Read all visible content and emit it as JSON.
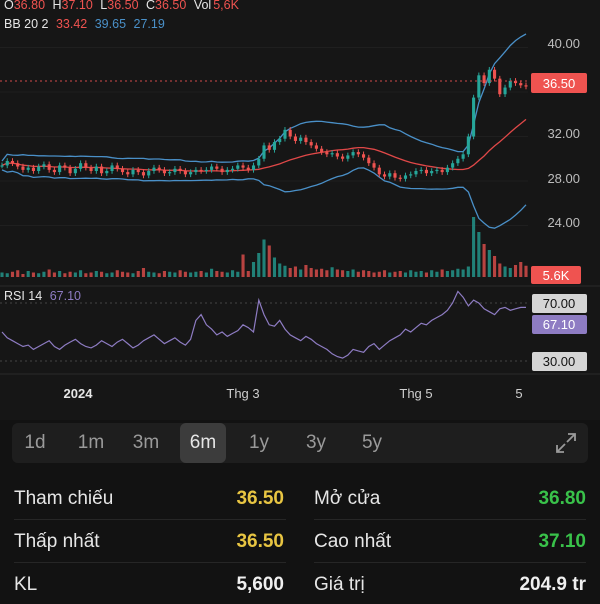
{
  "chart_data": {
    "type": "candlestick",
    "header": {
      "ohlc": [
        {
          "label": "O",
          "value": "36.80"
        },
        {
          "label": "H",
          "value": "37.10"
        },
        {
          "label": "L",
          "value": "36.50"
        },
        {
          "label": "C",
          "value": "36.50"
        },
        {
          "label": "Vol",
          "value": "5,6K"
        }
      ],
      "bb": {
        "label": "BB 20 2",
        "upper": "33.42",
        "middle": "39.65",
        "lower": "27.19"
      }
    },
    "price_axis": {
      "ticks": [
        "40.00",
        "36.00",
        "32.00",
        "28.00",
        "24.00"
      ],
      "ylim": [
        20,
        44
      ]
    },
    "current_price_label": "36.50",
    "volume_label": "5.6K",
    "rsi": {
      "label": "RSI 14",
      "value": "67.10",
      "levels": [
        "70.00",
        "30.00"
      ],
      "current_label": "67.10"
    },
    "x_ticks": [
      "2024",
      "Thg 3",
      "Thg 5",
      "5"
    ],
    "price_series": [
      29.4,
      29.8,
      29.6,
      29.3,
      29.0,
      29.2,
      28.9,
      29.3,
      29.5,
      29.0,
      28.8,
      29.4,
      29.2,
      28.7,
      29.1,
      29.6,
      29.2,
      28.9,
      29.3,
      28.7,
      28.9,
      29.4,
      29.1,
      28.8,
      28.6,
      29.0,
      28.8,
      28.5,
      28.9,
      29.2,
      29.0,
      28.7,
      28.8,
      29.1,
      28.9,
      28.6,
      28.8,
      29.0,
      28.9,
      29.0,
      29.3,
      29.1,
      28.8,
      29.0,
      29.1,
      29.4,
      29.2,
      29.0,
      29.4,
      30.0,
      31.2,
      30.8,
      31.5,
      31.8,
      32.6,
      32.0,
      31.6,
      31.9,
      31.5,
      31.2,
      30.9,
      30.6,
      30.4,
      30.5,
      30.2,
      30.0,
      30.3,
      30.6,
      30.4,
      30.1,
      29.6,
      29.2,
      28.6,
      28.4,
      28.7,
      28.3,
      28.2,
      28.5,
      28.6,
      28.9,
      29.0,
      28.7,
      28.9,
      29.0,
      28.8,
      29.2,
      29.6,
      30.0,
      30.4,
      32.0,
      35.5,
      37.5,
      36.8,
      38.0,
      37.2,
      35.8,
      36.4,
      37.0,
      36.8,
      36.6,
      36.5
    ],
    "volume_series": [
      0.6,
      0.5,
      0.7,
      0.9,
      0.4,
      0.8,
      0.6,
      0.5,
      0.7,
      1.0,
      0.6,
      0.8,
      0.5,
      0.7,
      0.6,
      0.9,
      0.5,
      0.6,
      0.8,
      0.7,
      0.5,
      0.6,
      0.9,
      0.7,
      0.6,
      0.5,
      0.8,
      1.2,
      0.7,
      0.6,
      0.5,
      0.8,
      0.7,
      0.6,
      0.9,
      0.7,
      0.6,
      0.7,
      0.8,
      0.6,
      1.1,
      0.8,
      0.7,
      0.6,
      0.9,
      0.7,
      3.0,
      0.8,
      2.0,
      3.2,
      5.0,
      4.2,
      2.6,
      1.8,
      1.5,
      1.2,
      1.4,
      1.0,
      1.6,
      1.2,
      1.0,
      1.1,
      0.9,
      1.3,
      1.0,
      0.9,
      0.8,
      1.0,
      0.7,
      0.9,
      0.8,
      0.6,
      0.7,
      0.9,
      0.6,
      0.7,
      0.8,
      0.6,
      0.9,
      0.7,
      0.8,
      0.6,
      0.9,
      0.7,
      1.0,
      0.8,
      0.9,
      1.1,
      1.0,
      1.4,
      8.0,
      6.0,
      4.4,
      3.6,
      2.8,
      1.8,
      1.4,
      1.2,
      1.6,
      2.0,
      1.5
    ],
    "rsi_series": [
      50,
      46,
      44,
      42,
      40,
      41,
      38,
      40,
      42,
      44,
      40,
      38,
      41,
      43,
      45,
      42,
      40,
      39,
      41,
      44,
      42,
      40,
      43,
      45,
      42,
      39,
      41,
      44,
      46,
      48,
      45,
      42,
      44,
      46,
      43,
      41,
      45,
      58,
      62,
      55,
      52,
      48,
      50,
      47,
      49,
      51,
      55,
      53,
      50,
      72,
      62,
      55,
      54,
      58,
      52,
      48,
      46,
      44,
      47,
      45,
      42,
      40,
      38,
      35,
      33,
      32,
      34,
      38,
      37,
      36,
      40,
      42,
      38,
      41,
      44,
      46,
      48,
      52,
      50,
      53,
      56,
      55,
      58,
      60,
      62,
      65,
      70,
      78,
      74,
      68,
      72,
      70,
      66,
      64,
      62,
      66,
      67,
      65,
      66,
      67,
      67
    ]
  },
  "range_tabs": [
    {
      "label": "1d",
      "active": false
    },
    {
      "label": "1m",
      "active": false
    },
    {
      "label": "3m",
      "active": false
    },
    {
      "label": "6m",
      "active": true
    },
    {
      "label": "1y",
      "active": false
    },
    {
      "label": "3y",
      "active": false
    },
    {
      "label": "5y",
      "active": false
    }
  ],
  "stats": {
    "rows": [
      {
        "left_label": "Tham chiếu",
        "left_value": "36.50",
        "left_color": "#e8c542",
        "right_label": "Mở cửa",
        "right_value": "36.80",
        "right_color": "#39c24a"
      },
      {
        "left_label": "Thấp nhất",
        "left_value": "36.50",
        "left_color": "#e8c542",
        "right_label": "Cao nhất",
        "right_value": "37.10",
        "right_color": "#39c24a"
      },
      {
        "left_label": "KL",
        "left_value": "5,600",
        "left_color": "#f0f0f0",
        "right_label": "Giá trị",
        "right_value": "204.9 tr",
        "right_color": "#f0f0f0"
      }
    ]
  },
  "colors": {
    "up": "#26a69a",
    "down": "#ef5350",
    "bb": "#4a90c8",
    "ma": "#e04848",
    "rsi": "#8e7cc3",
    "yellow": "#e8c542",
    "green": "#39c24a"
  }
}
